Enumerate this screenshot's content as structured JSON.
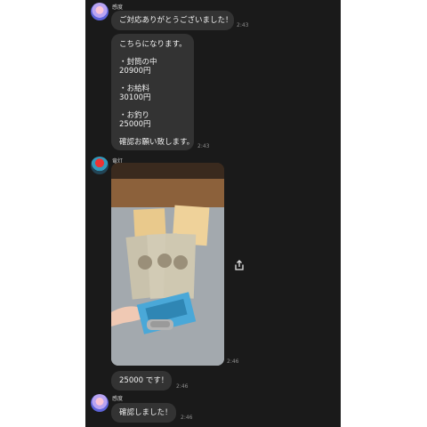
{
  "messages": [
    {
      "sender": "感度",
      "text": "ご対応ありがとうございました！",
      "time": "2:43"
    },
    {
      "lines": [
        "こちらになります。",
        "",
        "・封筒の中",
        "20900円",
        "",
        "・お給料",
        "30100円",
        "",
        "・お釣り",
        "25000円",
        "",
        "確認お願い致します。"
      ],
      "time": "2:43"
    },
    {
      "sender": "竜灯",
      "time": "2:46"
    },
    {
      "text": "25000 です！",
      "time": "2:46"
    },
    {
      "sender": "感度",
      "text": "確認しました！",
      "time": "2:46"
    }
  ],
  "icons": {
    "share": "share-icon"
  }
}
